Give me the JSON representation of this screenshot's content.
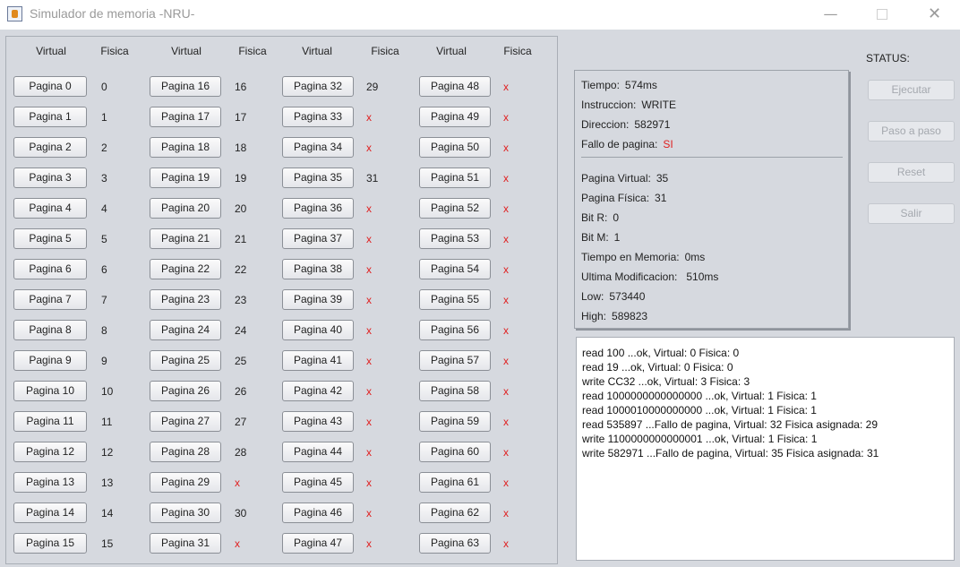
{
  "window": {
    "title": "Simulador de memoria -NRU-"
  },
  "columns": [
    {
      "virtual": "Virtual",
      "fisica": "Fisica"
    },
    {
      "virtual": "Virtual",
      "fisica": "Fisica"
    },
    {
      "virtual": "Virtual",
      "fisica": "Fisica"
    },
    {
      "virtual": "Virtual",
      "fisica": "Fisica"
    }
  ],
  "pages": [
    [
      "Pagina 0",
      "0"
    ],
    [
      "Pagina 1",
      "1"
    ],
    [
      "Pagina 2",
      "2"
    ],
    [
      "Pagina 3",
      "3"
    ],
    [
      "Pagina 4",
      "4"
    ],
    [
      "Pagina 5",
      "5"
    ],
    [
      "Pagina 6",
      "6"
    ],
    [
      "Pagina 7",
      "7"
    ],
    [
      "Pagina 8",
      "8"
    ],
    [
      "Pagina 9",
      "9"
    ],
    [
      "Pagina 10",
      "10"
    ],
    [
      "Pagina 11",
      "11"
    ],
    [
      "Pagina 12",
      "12"
    ],
    [
      "Pagina 13",
      "13"
    ],
    [
      "Pagina 14",
      "14"
    ],
    [
      "Pagina 15",
      "15"
    ],
    [
      "Pagina 16",
      "16"
    ],
    [
      "Pagina 17",
      "17"
    ],
    [
      "Pagina 18",
      "18"
    ],
    [
      "Pagina 19",
      "19"
    ],
    [
      "Pagina 20",
      "20"
    ],
    [
      "Pagina 21",
      "21"
    ],
    [
      "Pagina 22",
      "22"
    ],
    [
      "Pagina 23",
      "23"
    ],
    [
      "Pagina 24",
      "24"
    ],
    [
      "Pagina 25",
      "25"
    ],
    [
      "Pagina 26",
      "26"
    ],
    [
      "Pagina 27",
      "27"
    ],
    [
      "Pagina 28",
      "28"
    ],
    [
      "Pagina 29",
      "x"
    ],
    [
      "Pagina 30",
      "30"
    ],
    [
      "Pagina 31",
      "x"
    ],
    [
      "Pagina 32",
      "29"
    ],
    [
      "Pagina 33",
      "x"
    ],
    [
      "Pagina 34",
      "x"
    ],
    [
      "Pagina 35",
      "31"
    ],
    [
      "Pagina 36",
      "x"
    ],
    [
      "Pagina 37",
      "x"
    ],
    [
      "Pagina 38",
      "x"
    ],
    [
      "Pagina 39",
      "x"
    ],
    [
      "Pagina 40",
      "x"
    ],
    [
      "Pagina 41",
      "x"
    ],
    [
      "Pagina 42",
      "x"
    ],
    [
      "Pagina 43",
      "x"
    ],
    [
      "Pagina 44",
      "x"
    ],
    [
      "Pagina 45",
      "x"
    ],
    [
      "Pagina 46",
      "x"
    ],
    [
      "Pagina 47",
      "x"
    ],
    [
      "Pagina 48",
      "x"
    ],
    [
      "Pagina 49",
      "x"
    ],
    [
      "Pagina 50",
      "x"
    ],
    [
      "Pagina 51",
      "x"
    ],
    [
      "Pagina 52",
      "x"
    ],
    [
      "Pagina 53",
      "x"
    ],
    [
      "Pagina 54",
      "x"
    ],
    [
      "Pagina 55",
      "x"
    ],
    [
      "Pagina 56",
      "x"
    ],
    [
      "Pagina 57",
      "x"
    ],
    [
      "Pagina 58",
      "x"
    ],
    [
      "Pagina 59",
      "x"
    ],
    [
      "Pagina 60",
      "x"
    ],
    [
      "Pagina 61",
      "x"
    ],
    [
      "Pagina 62",
      "x"
    ],
    [
      "Pagina 63",
      "x"
    ]
  ],
  "info": {
    "tiempo_label": "Tiempo:",
    "tiempo": "574ms",
    "instruccion_label": "Instruccion:",
    "instruccion": "WRITE",
    "direccion_label": "Direccion:",
    "direccion": "582971",
    "fallo_label": "Fallo de pagina:",
    "fallo": "SI",
    "pagina_virtual_label": "Pagina Virtual:",
    "pagina_virtual": "35",
    "pagina_fisica_label": "Pagina Física:",
    "pagina_fisica": "31",
    "bit_r_label": "Bit R:",
    "bit_r": "0",
    "bit_m_label": "Bit M:",
    "bit_m": "1",
    "tiempo_memoria_label": "Tiempo en Memoria:",
    "tiempo_memoria": "0ms",
    "ultima_mod_label": "Ultima Modificacion:",
    "ultima_mod": "510ms",
    "low_label": "Low:",
    "low": "573440",
    "high_label": "High:",
    "high": "589823"
  },
  "status": {
    "label": "STATUS:",
    "ejecutar": "Ejecutar",
    "paso_a_paso": "Paso a paso",
    "reset": "Reset",
    "salir": "Salir"
  },
  "log": [
    "read 100 ...ok, Virtual: 0 Fisica: 0",
    "read 19 ...ok, Virtual: 0 Fisica: 0",
    "write CC32 ...ok, Virtual: 3 Fisica: 3",
    "read 1000000000000000 ...ok, Virtual: 1 Fisica: 1",
    "read 1000010000000000 ...ok, Virtual: 1 Fisica: 1",
    "read 535897 ...Fallo de pagina, Virtual: 32 Fisica asignada: 29",
    "write 1100000000000001 ...ok, Virtual: 1 Fisica: 1",
    "write 582971 ...Fallo de pagina, Virtual: 35 Fisica asignada: 31"
  ],
  "colors": {
    "miss": "#e02020"
  }
}
